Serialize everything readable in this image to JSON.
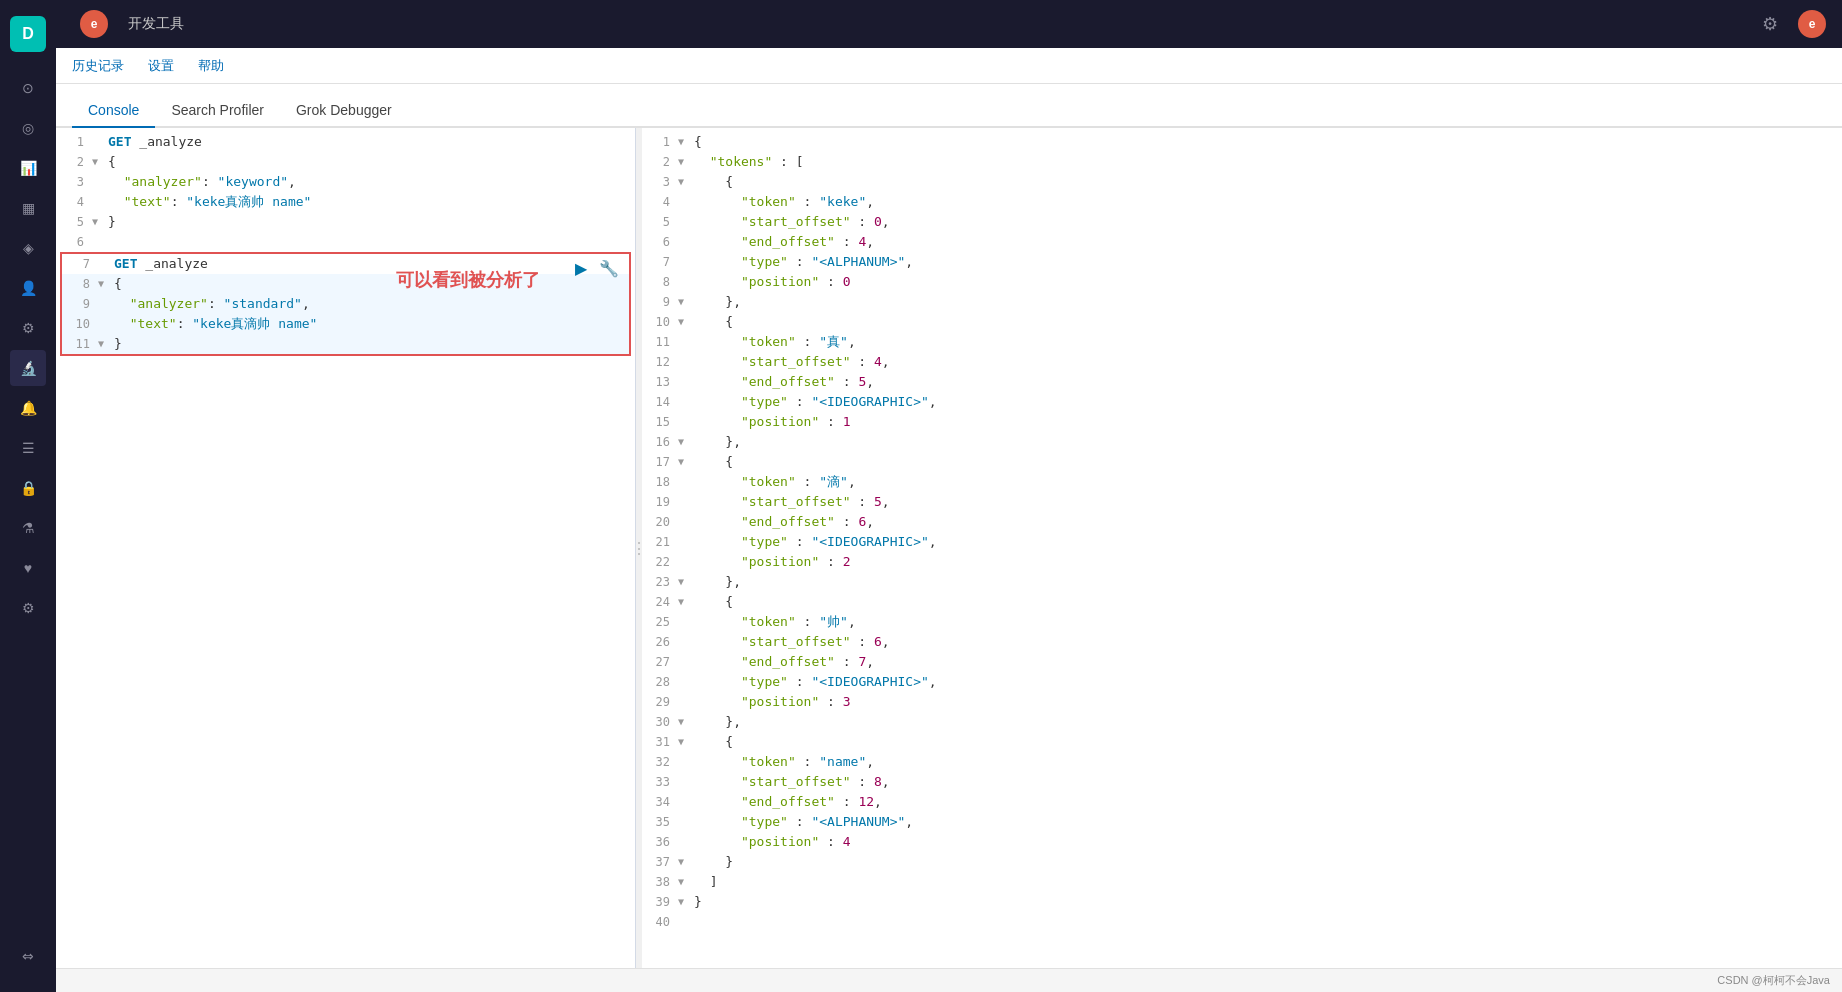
{
  "app": {
    "title": "开发工具",
    "logo_letter": "D",
    "user_letter": "e"
  },
  "secondnav": {
    "items": [
      "历史记录",
      "设置",
      "帮助"
    ]
  },
  "tabs": {
    "items": [
      "Console",
      "Search Profiler",
      "Grok Debugger"
    ],
    "active": "Console"
  },
  "editor": {
    "lines": [
      {
        "num": "1",
        "toggle": "",
        "content": "GET _analyze",
        "style": "get"
      },
      {
        "num": "2",
        "toggle": "▼",
        "content": "{",
        "style": "plain"
      },
      {
        "num": "3",
        "toggle": "",
        "content": "  \"analyzer\": \"keyword\",",
        "style": "kv"
      },
      {
        "num": "4",
        "toggle": "",
        "content": "  \"text\": \"keke真滴帅 name\"",
        "style": "kv"
      },
      {
        "num": "5",
        "toggle": "▼",
        "content": "}",
        "style": "plain"
      },
      {
        "num": "6",
        "toggle": "",
        "content": "",
        "style": "plain"
      },
      {
        "num": "7",
        "toggle": "",
        "content": "GET _analyze",
        "style": "get",
        "selected": true
      },
      {
        "num": "8",
        "toggle": "▼",
        "content": "{",
        "style": "plain",
        "selected": true
      },
      {
        "num": "9",
        "toggle": "",
        "content": "  \"analyzer\": \"standard\",",
        "style": "kv",
        "selected": true
      },
      {
        "num": "10",
        "toggle": "",
        "content": "  \"text\": \"keke真滴帅 name\"",
        "style": "kv",
        "selected": true
      },
      {
        "num": "11",
        "toggle": "▼",
        "content": "}",
        "style": "plain",
        "selected": true
      }
    ],
    "annotation": "可以看到被分析了",
    "run_tooltip": "Run",
    "wrench_tooltip": "Settings"
  },
  "output": {
    "lines": [
      {
        "num": "1",
        "toggle": "▼",
        "content": "{",
        "indent": 0
      },
      {
        "num": "2",
        "toggle": "▼",
        "content": "  \"tokens\" : [",
        "indent": 1
      },
      {
        "num": "3",
        "toggle": "▼",
        "content": "    {",
        "indent": 2
      },
      {
        "num": "4",
        "toggle": "",
        "content": "      \"token\" : \"keke\",",
        "indent": 3
      },
      {
        "num": "5",
        "toggle": "",
        "content": "      \"start_offset\" : 0,",
        "indent": 3
      },
      {
        "num": "6",
        "toggle": "",
        "content": "      \"end_offset\" : 4,",
        "indent": 3
      },
      {
        "num": "7",
        "toggle": "",
        "content": "      \"type\" : \"<ALPHANUM>\",",
        "indent": 3
      },
      {
        "num": "8",
        "toggle": "",
        "content": "      \"position\" : 0",
        "indent": 3
      },
      {
        "num": "9",
        "toggle": "▼",
        "content": "    },",
        "indent": 2
      },
      {
        "num": "10",
        "toggle": "▼",
        "content": "    {",
        "indent": 2
      },
      {
        "num": "11",
        "toggle": "",
        "content": "      \"token\" : \"真\",",
        "indent": 3
      },
      {
        "num": "12",
        "toggle": "",
        "content": "      \"start_offset\" : 4,",
        "indent": 3
      },
      {
        "num": "13",
        "toggle": "",
        "content": "      \"end_offset\" : 5,",
        "indent": 3
      },
      {
        "num": "14",
        "toggle": "",
        "content": "      \"type\" : \"<IDEOGRAPHIC>\",",
        "indent": 3
      },
      {
        "num": "15",
        "toggle": "",
        "content": "      \"position\" : 1",
        "indent": 3
      },
      {
        "num": "16",
        "toggle": "▼",
        "content": "    },",
        "indent": 2
      },
      {
        "num": "17",
        "toggle": "▼",
        "content": "    {",
        "indent": 2
      },
      {
        "num": "18",
        "toggle": "",
        "content": "      \"token\" : \"滴\",",
        "indent": 3
      },
      {
        "num": "19",
        "toggle": "",
        "content": "      \"start_offset\" : 5,",
        "indent": 3
      },
      {
        "num": "20",
        "toggle": "",
        "content": "      \"end_offset\" : 6,",
        "indent": 3
      },
      {
        "num": "21",
        "toggle": "",
        "content": "      \"type\" : \"<IDEOGRAPHIC>\",",
        "indent": 3
      },
      {
        "num": "22",
        "toggle": "",
        "content": "      \"position\" : 2",
        "indent": 3
      },
      {
        "num": "23",
        "toggle": "▼",
        "content": "    },",
        "indent": 2
      },
      {
        "num": "24",
        "toggle": "▼",
        "content": "    {",
        "indent": 2
      },
      {
        "num": "25",
        "toggle": "",
        "content": "      \"token\" : \"帅\",",
        "indent": 3
      },
      {
        "num": "26",
        "toggle": "",
        "content": "      \"start_offset\" : 6,",
        "indent": 3
      },
      {
        "num": "27",
        "toggle": "",
        "content": "      \"end_offset\" : 7,",
        "indent": 3
      },
      {
        "num": "28",
        "toggle": "",
        "content": "      \"type\" : \"<IDEOGRAPHIC>\",",
        "indent": 3
      },
      {
        "num": "29",
        "toggle": "",
        "content": "      \"position\" : 3",
        "indent": 3
      },
      {
        "num": "30",
        "toggle": "▼",
        "content": "    },",
        "indent": 2
      },
      {
        "num": "31",
        "toggle": "▼",
        "content": "    {",
        "indent": 2
      },
      {
        "num": "32",
        "toggle": "",
        "content": "      \"token\" : \"name\",",
        "indent": 3
      },
      {
        "num": "33",
        "toggle": "",
        "content": "      \"start_offset\" : 8,",
        "indent": 3
      },
      {
        "num": "34",
        "toggle": "",
        "content": "      \"end_offset\" : 12,",
        "indent": 3
      },
      {
        "num": "35",
        "toggle": "",
        "content": "      \"type\" : \"<ALPHANUM>\",",
        "indent": 3
      },
      {
        "num": "36",
        "toggle": "",
        "content": "      \"position\" : 4",
        "indent": 3
      },
      {
        "num": "37",
        "toggle": "▼",
        "content": "    }",
        "indent": 2
      },
      {
        "num": "38",
        "toggle": "▼",
        "content": "  ]",
        "indent": 1
      },
      {
        "num": "39",
        "toggle": "▼",
        "content": "}",
        "indent": 0
      },
      {
        "num": "40",
        "toggle": "",
        "content": "",
        "indent": 0
      }
    ]
  },
  "footer": {
    "text": "CSDN @柯柯不会Java"
  },
  "sidebar": {
    "icons": [
      {
        "name": "clock-icon",
        "glyph": "🕐",
        "label": "History"
      },
      {
        "name": "target-icon",
        "glyph": "⊙",
        "label": "Discover"
      },
      {
        "name": "bar-chart-icon",
        "glyph": "▦",
        "label": "Visualize"
      },
      {
        "name": "dashboard-icon",
        "glyph": "▣",
        "label": "Dashboard"
      },
      {
        "name": "canvas-icon",
        "glyph": "◈",
        "label": "Canvas"
      },
      {
        "name": "user-icon",
        "glyph": "👤",
        "label": "User"
      },
      {
        "name": "settings-cog-icon",
        "glyph": "⚙",
        "label": "Settings"
      },
      {
        "name": "beaker-icon",
        "glyph": "🔬",
        "label": "Dev Tools"
      },
      {
        "name": "alert-icon",
        "glyph": "🔔",
        "label": "Alerts"
      },
      {
        "name": "stack-icon",
        "glyph": "☰",
        "label": "APM"
      },
      {
        "name": "lock-icon",
        "glyph": "🔒",
        "label": "Security"
      },
      {
        "name": "flask-icon",
        "glyph": "⚗",
        "label": "ML"
      },
      {
        "name": "heart-icon",
        "glyph": "♥",
        "label": "Uptime"
      },
      {
        "name": "gear-icon",
        "glyph": "⚙",
        "label": "Management"
      }
    ],
    "bottom_icon": {
      "name": "expand-icon",
      "glyph": "⇔",
      "label": "Expand"
    }
  }
}
